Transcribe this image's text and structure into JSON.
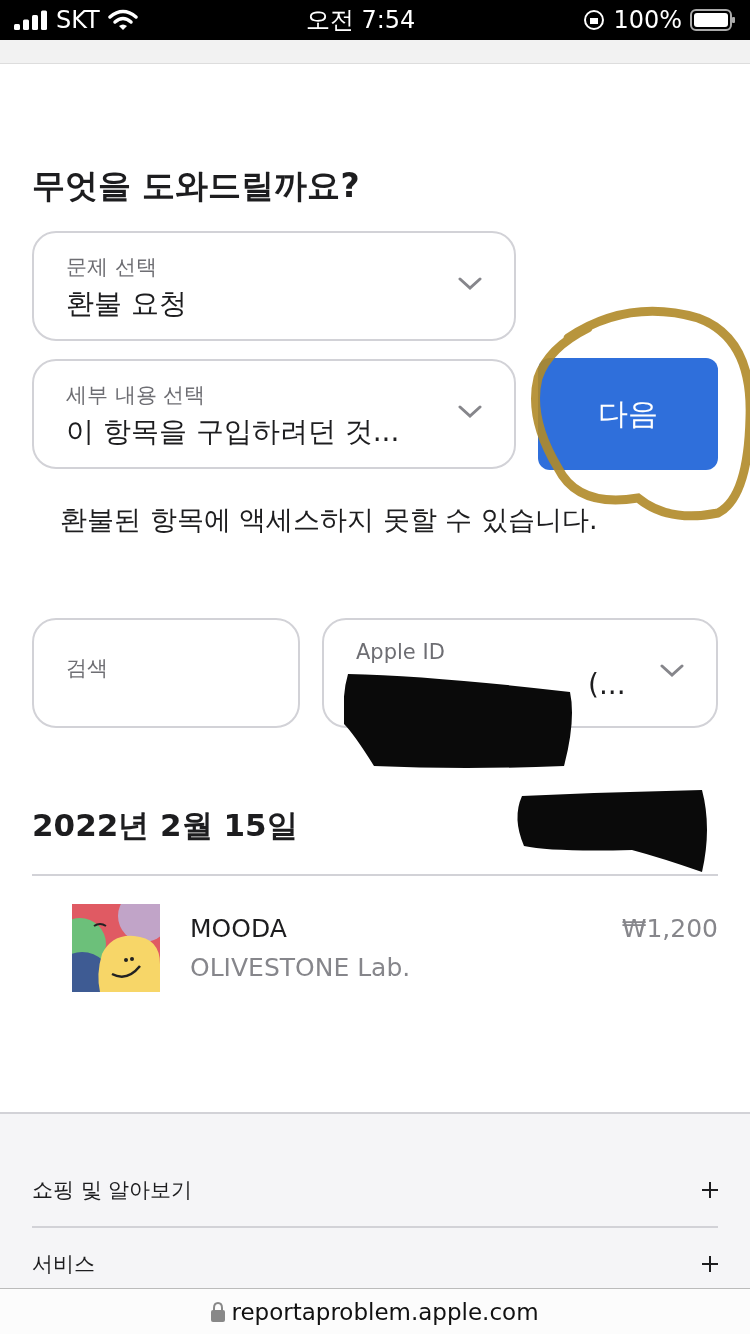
{
  "status_bar": {
    "carrier": "SKT",
    "time": "오전 7:54",
    "battery": "100%"
  },
  "heading": "무엇을 도와드릴까요?",
  "selects": [
    {
      "label": "문제 선택",
      "value": "환불 요청"
    },
    {
      "label": "세부 내용 선택",
      "value": "이 항목을 구입하려던 것..."
    }
  ],
  "next_button": "다음",
  "notice": "환불된 항목에 액세스하지 못할 수 있습니다.",
  "search": {
    "placeholder": "검색"
  },
  "account_select": {
    "label": "Apple ID",
    "value": "(..."
  },
  "order": {
    "date": "2022년 2월 15일"
  },
  "items": [
    {
      "name": "MOODA",
      "developer": "OLIVESTONE Lab.",
      "price": "₩1,200"
    }
  ],
  "footer": {
    "sections": [
      {
        "label": "쇼핑 및 알아보기",
        "expanded": false
      },
      {
        "label": "서비스",
        "expanded": false
      }
    ]
  },
  "address_bar": {
    "url": "reportaproblem.apple.com",
    "secure": true
  }
}
